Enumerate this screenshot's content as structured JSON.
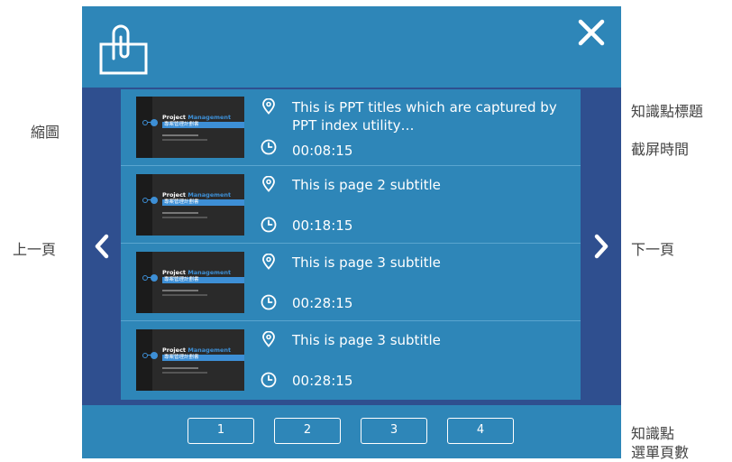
{
  "annotations": {
    "thumbnail": "縮圖",
    "prev_page": "上一頁",
    "title_label": "知識點標題",
    "capture_time": "截屏時間",
    "next_page": "下一頁",
    "menu_pages_line1": "知識點",
    "menu_pages_line2": "選單頁數"
  },
  "thumbnail": {
    "title_a": "Project",
    "title_b": "Management",
    "subtitle": "專案管理計劃書"
  },
  "items": [
    {
      "title": "This is PPT titles which are captured by PPT index utility…",
      "time": "00:08:15"
    },
    {
      "title": "This is page 2 subtitle",
      "time": "00:18:15"
    },
    {
      "title": "This is page 3 subtitle",
      "time": "00:28:15"
    },
    {
      "title": "This is page 3 subtitle",
      "time": "00:28:15"
    }
  ],
  "pages": [
    "1",
    "2",
    "3",
    "4"
  ],
  "icons": {
    "header": "clipboard-icon",
    "close": "close-icon",
    "prev": "chevron-left-icon",
    "next": "chevron-right-icon",
    "location": "location-pin-icon",
    "time": "clock-icon"
  },
  "colors": {
    "panel": "#2e86b8",
    "side": "#2f4f8f",
    "accent": "#3d8fd6"
  }
}
